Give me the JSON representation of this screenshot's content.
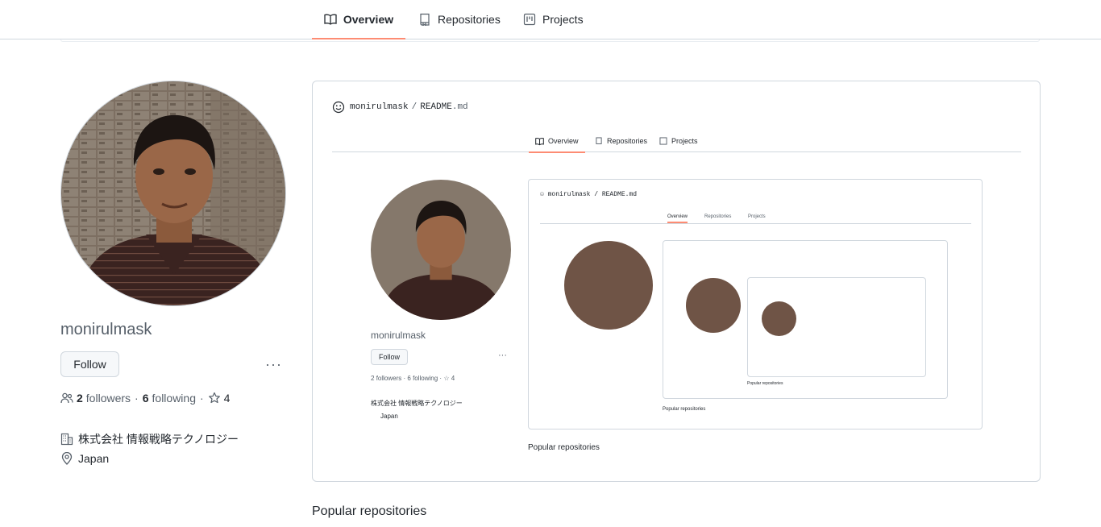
{
  "nav": {
    "tabs": [
      {
        "label": "Overview",
        "icon": "book-icon",
        "active": true
      },
      {
        "label": "Repositories",
        "icon": "repo-icon",
        "active": false
      },
      {
        "label": "Projects",
        "icon": "project-icon",
        "active": false
      }
    ]
  },
  "profile": {
    "username": "monirulmask",
    "follow_label": "Follow",
    "followers_count": "2",
    "followers_label": "followers",
    "following_count": "6",
    "following_label": "following",
    "stars_count": "4",
    "organization": "株式会社 情報戦略テクノロジー",
    "location": "Japan"
  },
  "readme": {
    "owner": "monirulmask",
    "file_name": "README",
    "file_ext": ".md"
  },
  "popular_repositories_label": "Popular repositories",
  "colors": {
    "accent_underline": "#fd8c73",
    "border": "#d0d7de",
    "muted_text": "#57606a"
  }
}
